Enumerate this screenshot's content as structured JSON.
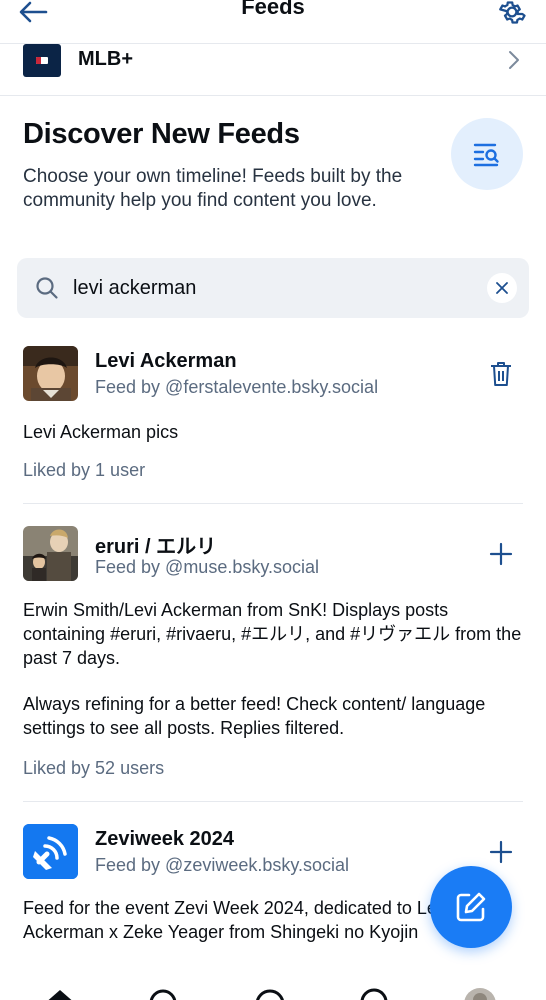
{
  "header": {
    "title": "Feeds",
    "back_icon": "arrow-left-icon",
    "settings_icon": "gear-icon"
  },
  "pinned": {
    "label": "MLB+",
    "logo_icon": "mlb-logo-icon"
  },
  "discover": {
    "title": "Discover New Feeds",
    "description": "Choose your own timeline! Feeds built by the community help you find content you love.",
    "button_icon": "list-search-icon"
  },
  "search": {
    "value": "levi ackerman",
    "placeholder": ""
  },
  "feeds": [
    {
      "name": "Levi Ackerman",
      "by": "Feed by @ferstalevente.bsky.social",
      "description": "Levi Ackerman pics",
      "liked": "Liked by 1 user",
      "action_icon": "trash-icon"
    },
    {
      "name": "eruri / エルリ",
      "by": "Feed by @muse.bsky.social",
      "description_1": "Erwin Smith/Levi Ackerman from SnK! Displays posts containing #eruri, #rivaeru, #エルリ, and #リヴァエル from the past 7 days.",
      "description_2": "Always refining for a better feed! Check content/ language settings to see all posts. Replies filtered.",
      "liked": "Liked by 52 users",
      "action_icon": "plus-icon"
    },
    {
      "name": "Zeviweek 2024",
      "by": "Feed by @zeviweek.bsky.social",
      "description": "Feed for the event Zevi Week 2024, dedicated to Levi Ackerman x Zeke Yeager from Shingeki no Kyojin",
      "action_icon": "plus-icon"
    }
  ],
  "fab_icon": "compose-icon",
  "colors": {
    "accent": "#1a7cf5",
    "muted": "#5b6b80",
    "search_bg": "#eef1f5"
  }
}
